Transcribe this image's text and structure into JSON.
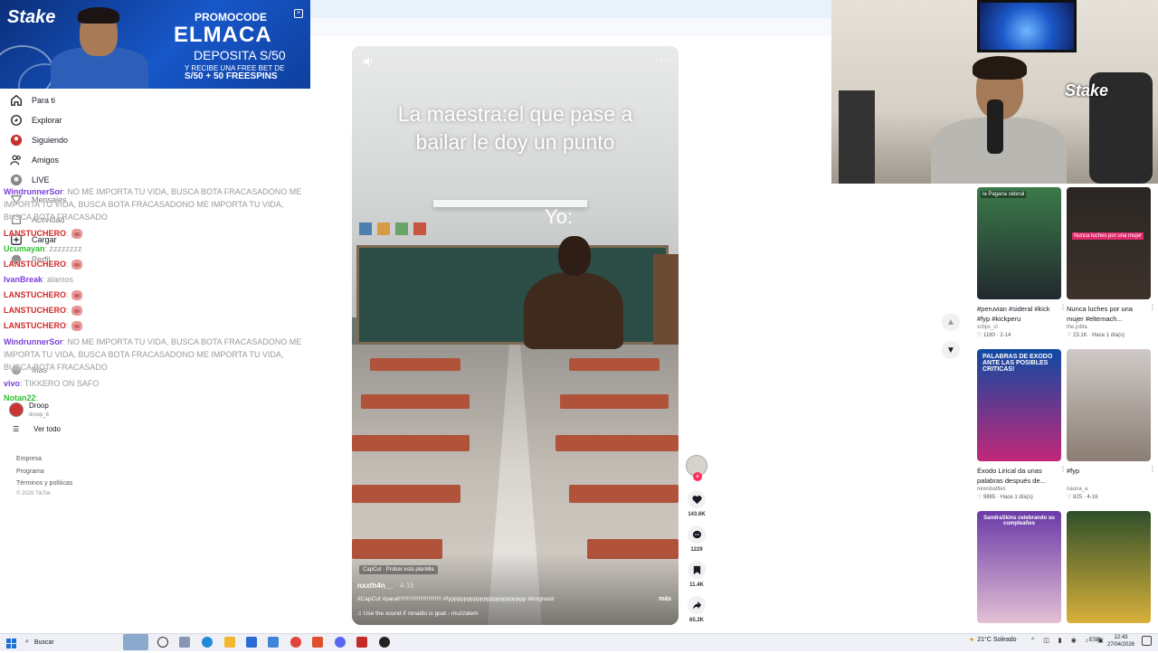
{
  "promo": {
    "brand": "Stake",
    "label": "PROMOCODE",
    "code": "ELMACA",
    "deposit": "DEPOSITA S/50",
    "free_bet": "Y RECIBE UNA FREE BET DE",
    "spins": "S/50 + 50 FREESPINS"
  },
  "sidebar": {
    "items": [
      {
        "label": "Para ti",
        "icon": "home-icon"
      },
      {
        "label": "Explorar",
        "icon": "compass-icon"
      },
      {
        "label": "Siguiendo",
        "icon": "following-icon"
      },
      {
        "label": "Amigos",
        "icon": "friends-icon"
      },
      {
        "label": "LIVE",
        "icon": "live-icon"
      },
      {
        "label": "Mensajes",
        "icon": "message-icon"
      },
      {
        "label": "Actividad",
        "icon": "activity-icon"
      },
      {
        "label": "Cargar",
        "icon": "upload-icon"
      },
      {
        "label": "Perfil",
        "icon": "profile-icon"
      },
      {
        "label": "Más",
        "icon": "more-icon"
      }
    ],
    "following": [
      {
        "name": "Droop",
        "sub": "droop_6"
      }
    ],
    "see_all": "Ver todo",
    "footer": [
      "Empresa",
      "Programa",
      "Términos y políticas",
      "© 2026 TikTok"
    ]
  },
  "chat": [
    {
      "user": "WindrunnerSor",
      "color": "#7b3fd6",
      "msg": ": NO ME IMPORTA TU VIDA, BUSCA BOTA FRACASADONO ME IMPORTA TU VIDA, BUSCA BOTA FRACASADONO ME IMPORTA TU VIDA, BUSCA BOTA FRACASADO"
    },
    {
      "user": "LANSTUCHERO",
      "color": "#d12a2a",
      "msg": ":",
      "emote": true
    },
    {
      "user": "Ucumayan",
      "color": "#2fbf2f",
      "msg": ": zzzzzzzz"
    },
    {
      "user": "LANSTUCHERO",
      "color": "#d12a2a",
      "msg": ":",
      "emote": true
    },
    {
      "user": "IvanBreak",
      "color": "#7b3fd6",
      "msg": ": alamos"
    },
    {
      "user": "LANSTUCHERO",
      "color": "#d12a2a",
      "msg": ":",
      "emote": true
    },
    {
      "user": "LANSTUCHERO",
      "color": "#d12a2a",
      "msg": ":",
      "emote": true
    },
    {
      "user": "LANSTUCHERO",
      "color": "#d12a2a",
      "msg": ":",
      "emote": true
    },
    {
      "user": "WindrunnerSor",
      "color": "#7b3fd6",
      "msg": ": NO ME IMPORTA TU VIDA, BUSCA BOTA FRACASADONO ME IMPORTA TU VIDA, BUSCA BOTA FRACASADONO ME IMPORTA TU VIDA, BUSCA BOTA FRACASADO"
    },
    {
      "user": "vivo",
      "color": "#7b3fd6",
      "msg": ": TIKKERO ON SAFO"
    },
    {
      "user": "Notan22",
      "color": "#2fbf2f",
      "msg": ":"
    }
  ],
  "video": {
    "caption_line1": "La maestra:el que pase a",
    "caption_line2": "bailar le doy un punto",
    "caption_yo": "Yo:",
    "capcut": "CapCut · Probar esta plantilla",
    "author": "nxxth4n__",
    "date": "· 4-16",
    "description": "#CapCut #parat!!!!!!!!!!!!!!!!!!!!!!!!!! #fyppppppppppppppppppppppp #kingnasir",
    "more": "más",
    "sound": "♫  Use the sound if ronaldo is goat - muzzalem"
  },
  "actions": {
    "likes": "143.6K",
    "comments": "1229",
    "saves": "11.4K",
    "shares": "65.2K"
  },
  "recommendations": [
    {
      "title": "#peruvian #sideral #kick #fyp #kickperu",
      "author": "xclips_cl",
      "likes": "1180",
      "date": "2-14",
      "badge": "la Pagana sideral",
      "thumb_top": "#3b7a4a",
      "thumb_bottom": "#22292e"
    },
    {
      "title": "Nunca luches por una mujer #eltemach...",
      "author": "the.jotita",
      "likes": "23.1K",
      "date": "Hace 1 día(s)",
      "badge": "Nunca luches por una mujer",
      "thumb_top": "#2a2623",
      "thumb_bottom": "#3e322b"
    },
    {
      "title": "Éxodo Lirical da unas palabras después de...",
      "author": "newsbattles",
      "likes": "9865",
      "date": "Hace 1 día(s)",
      "badge": "PALABRAS DE EXODO ANTE LAS POSIBLES CRITICAS!",
      "thumb_top": "#0f4aa3",
      "thumb_bottom": "#c22778"
    },
    {
      "title": "#fyp",
      "author": "nauna_a",
      "likes": "825",
      "date": "4-16",
      "badge": "",
      "thumb_top": "#cfcac7",
      "thumb_bottom": "#8b7d73"
    },
    {
      "title": "",
      "author": "",
      "likes": "",
      "date": "",
      "badge": "SandraSkins celebrando su cumpleaños",
      "thumb_top": "#6b3aa8",
      "thumb_bottom": "#e3c0d4"
    },
    {
      "title": "",
      "author": "",
      "likes": "",
      "date": "",
      "badge": "",
      "thumb_top": "#2f4f2a",
      "thumb_bottom": "#d8b03a"
    }
  ],
  "taskbar": {
    "search": "Buscar",
    "weather": "21°C  Soleado",
    "lang": "ESP",
    "time": "12:43",
    "date": "27/04/2026"
  },
  "webcam": {
    "logo": "Stake"
  }
}
